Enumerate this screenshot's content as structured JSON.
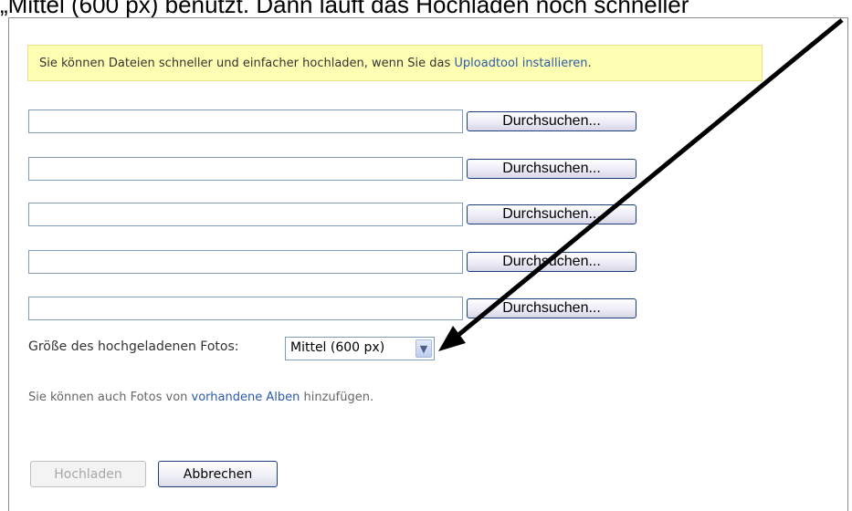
{
  "caption": "„Mittel (600 px) benützt. Dann läuft das Hochladen noch schneller",
  "notice": {
    "text_before": "Sie können Dateien schneller und einfacher hochladen, wenn Sie das ",
    "link": "Uploadtool installieren",
    "text_after": "."
  },
  "file_rows": [
    {
      "value": "",
      "browse_label": "Durchsuchen..."
    },
    {
      "value": "",
      "browse_label": "Durchsuchen..."
    },
    {
      "value": "",
      "browse_label": "Durchsuchen..."
    },
    {
      "value": "",
      "browse_label": "Durchsuchen..."
    },
    {
      "value": "",
      "browse_label": "Durchsuchen..."
    }
  ],
  "size": {
    "label": "Größe des hochgeladenen Fotos:",
    "selected": "Mittel (600 px)"
  },
  "hint": {
    "text_before": "Sie können auch Fotos von ",
    "link": "vorhandene Alben",
    "text_after": " hinzufügen."
  },
  "buttons": {
    "upload": "Hochladen",
    "cancel": "Abbrechen"
  },
  "colors": {
    "notice_bg": "#ffffb3",
    "link": "#2b5aa8",
    "arrow": "#000000"
  }
}
